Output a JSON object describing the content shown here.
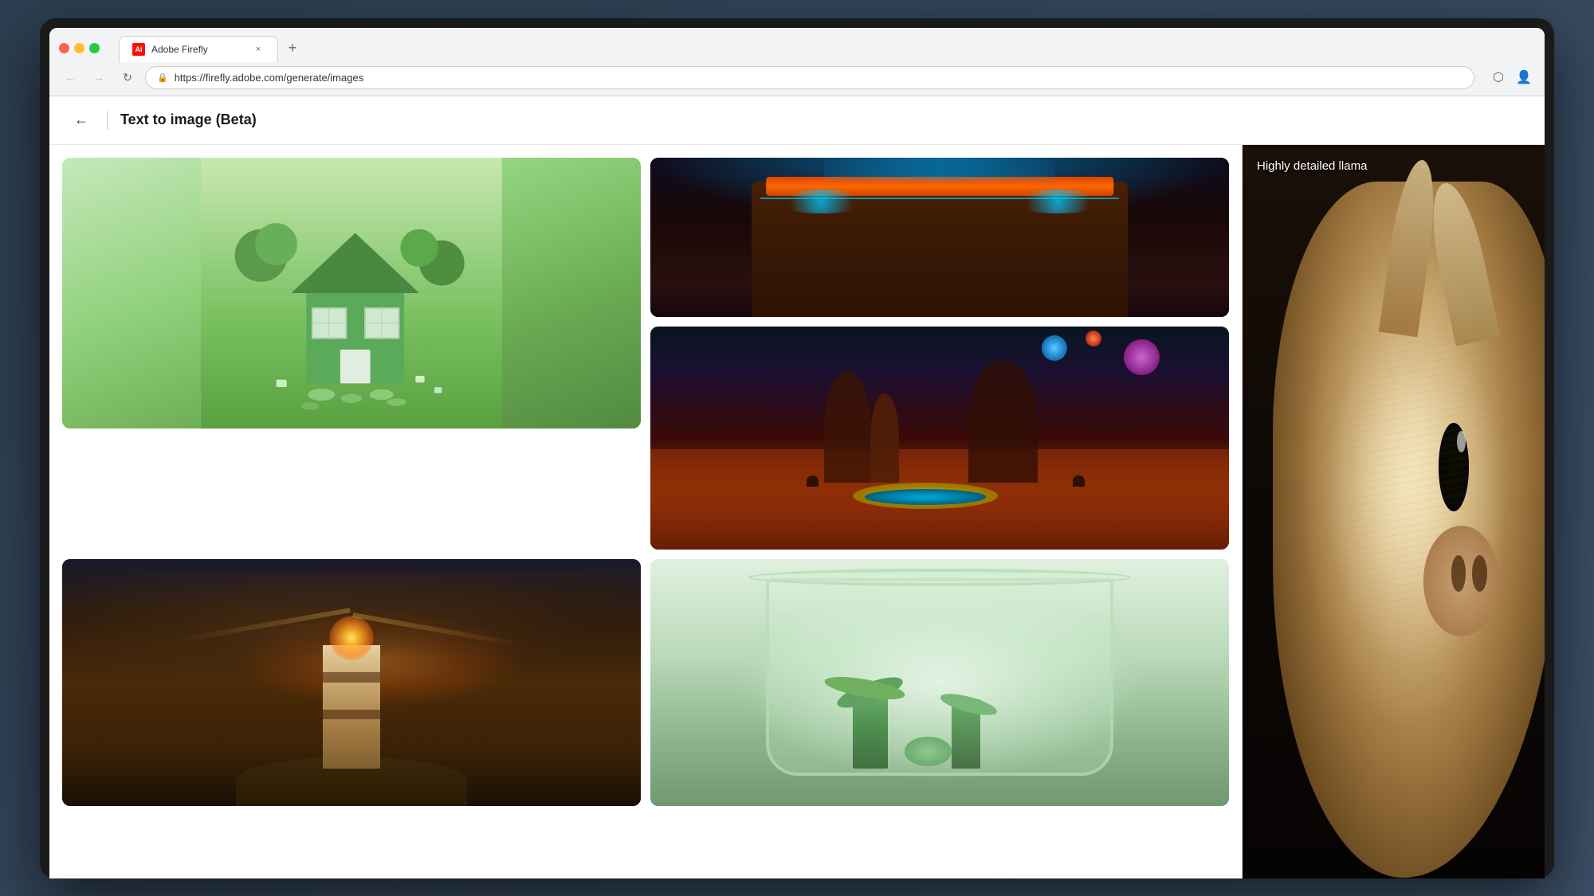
{
  "browser": {
    "tab_title": "Adobe Firefly",
    "url": "https://firefly.adobe.com/generate/images",
    "tab_close_label": "×",
    "tab_new_label": "+",
    "nav_back": "←",
    "nav_forward": "→",
    "nav_refresh": "↻",
    "lock_icon": "🔒"
  },
  "app": {
    "page_title": "Text to image (Beta)",
    "back_label": "←"
  },
  "gallery": {
    "images": [
      {
        "id": "house",
        "alt": "3D isometric green house with trees",
        "prompt": "3D isometric green house"
      },
      {
        "id": "robot",
        "alt": "Cyberpunk robot with neon collar",
        "prompt": "Cyberpunk character"
      },
      {
        "id": "scifi",
        "alt": "Sci-fi alien landscape with planets",
        "prompt": "Sci-fi landscape"
      },
      {
        "id": "lighthouse",
        "alt": "Lighthouse in stormy sky",
        "prompt": "Lighthouse storm"
      },
      {
        "id": "jar",
        "alt": "Glass jar with plants terrarium",
        "prompt": "Terrarium jar"
      }
    ],
    "side_panel": {
      "label": "Highly detailed llama",
      "alt": "Highly detailed llama portrait"
    }
  }
}
